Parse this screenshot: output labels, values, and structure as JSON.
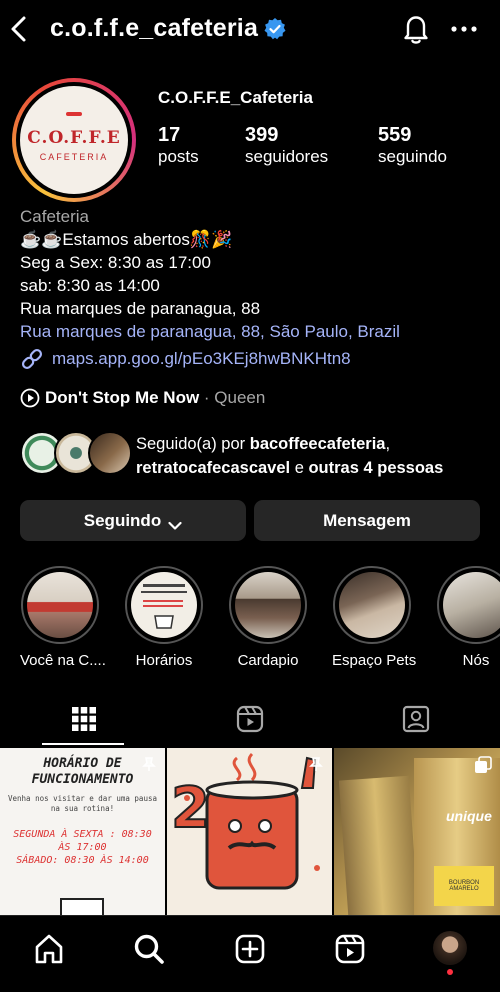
{
  "header": {
    "username": "c.o.f.f.e_cafeteria",
    "icons": [
      "back-arrow-icon",
      "verified-badge-icon",
      "bell-icon",
      "more-dots-icon"
    ]
  },
  "profile": {
    "logo_text": "C.O.F.F.E",
    "logo_sub": "CAFETERIA",
    "display_name": "C.O.F.F.E_Cafeteria",
    "stats": [
      {
        "value": "17",
        "label": "posts"
      },
      {
        "value": "399",
        "label": "seguidores"
      },
      {
        "value": "559",
        "label": "seguindo"
      }
    ]
  },
  "bio": {
    "category": "Cafeteria",
    "lines": [
      "☕☕Estamos abertos🎊🎉",
      "Seg a Sex: 8:30 as 17:00",
      "sab: 8:30 as 14:00",
      "Rua marques de paranagua, 88"
    ],
    "address": "Rua marques de paranagua, 88, São Paulo, Brazil",
    "link": "maps.app.goo.gl/pEo3KEj8hwBNKHtn8"
  },
  "music": {
    "song": "Don't Stop Me Now",
    "separator": " · ",
    "artist": "Queen"
  },
  "followed_by": {
    "prefix": "Seguido(a) por ",
    "user1": "bacoffeecafeteria",
    "comma": ",",
    "user2": "retratocafecascavel",
    "middle": " e ",
    "others": "outras 4 pessoas"
  },
  "buttons": {
    "following": "Seguindo",
    "message": "Mensagem"
  },
  "highlights": [
    {
      "label": "Você na C...."
    },
    {
      "label": "Horários"
    },
    {
      "label": "Cardapio"
    },
    {
      "label": "Espaço Pets"
    },
    {
      "label": "Nós"
    }
  ],
  "posts": {
    "post1": {
      "title1": "HORÁRIO DE",
      "title2": "FUNCIONAMENTO",
      "subtitle": "Venha nos visitar e dar uma pausa na sua rotina!",
      "line1": "SEGUNDA À SEXTA : 08:30",
      "line1b": "ÀS 17:00",
      "line2": "SÁBADO: 08:30 ÀS 14:00"
    },
    "post2": {
      "number": "2"
    },
    "post3": {
      "brand": "unique",
      "label": "BOURBON AMARELO"
    }
  },
  "colors": {
    "link": "#a5b4f8",
    "muted": "#a8a8a8",
    "button_bg": "#262626",
    "verified": "#3897f0",
    "brand_red": "#c0262a"
  }
}
